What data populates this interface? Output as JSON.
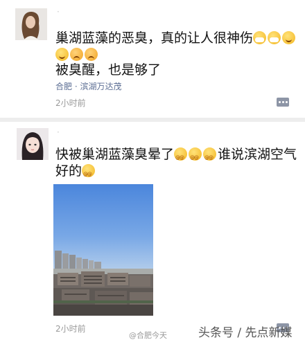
{
  "post1": {
    "username": "·",
    "text_line1": "巢湖蓝藻的恶臭，真的让人很神伤",
    "emoji_line1": [
      "mask-face-icon",
      "mask-face-icon",
      "grin-face-icon"
    ],
    "emoji_line2": [
      "grin-face-icon",
      "sad-face-icon",
      "sad-face-icon"
    ],
    "text_line3": "被臭醒，也是够了",
    "location": "合肥 · 滨湖万达茂",
    "time": "2小时前"
  },
  "post2": {
    "username": "·",
    "text_line1": "快被巢湖蓝藻臭晕了",
    "emoji_mid": [
      "dizzy-face-icon",
      "dizzy-face-icon",
      "dizzy-face-icon"
    ],
    "text_line1_tail": "谁说滨湖空气",
    "text_line2": "好的",
    "emoji_end": [
      "dizzy-face-icon"
    ],
    "time": "2小时前"
  },
  "watermarks": {
    "left": "@合肥今天",
    "right": "头条号 / 先点新媒"
  },
  "colors": {
    "link": "#5b6d93",
    "meta": "#9a9a9a",
    "comment_button": "#8d95a6",
    "sky": "#4b86dc"
  }
}
